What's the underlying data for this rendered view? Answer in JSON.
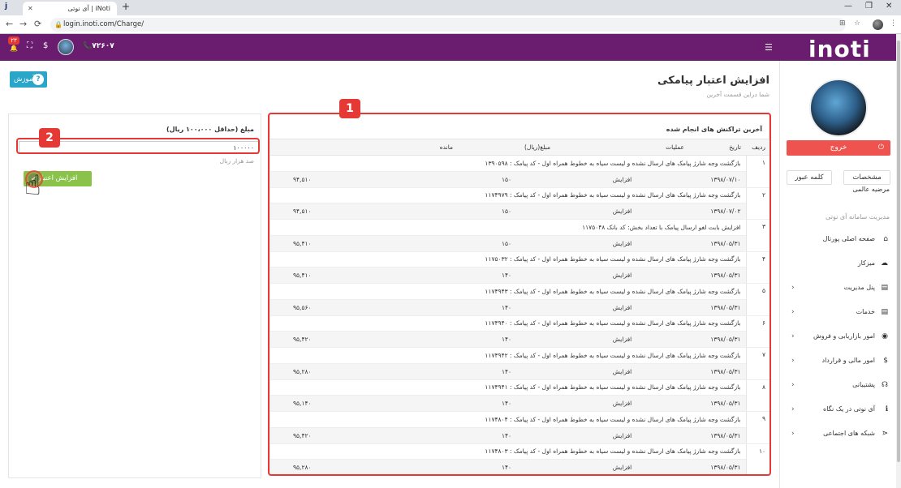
{
  "browser": {
    "tab_title": "iNoti | آی نوتی",
    "url": "login.inoti.com/Charge/",
    "new_tab": "+",
    "back": "←",
    "forward": "→",
    "reload": "⟳",
    "minimize": "—",
    "maximize": "❐",
    "close": "✕"
  },
  "header": {
    "logo": "inoti",
    "phone": "۷۲۶۰۷",
    "badge": "۲۳"
  },
  "page": {
    "title": "افزایش اعتبار پیامکی",
    "subtitle": "شما دراین قسمت آخرین",
    "help_label": "آموزش"
  },
  "charge_form": {
    "label": "مبلغ (حداقل ۱۰۰،۰۰۰ ریال)",
    "value": "۱۰۰۰۰۰",
    "hint": "صد هزار ریال",
    "submit_label": "افزایش اعتبار"
  },
  "transactions": {
    "title": "آخرین تراکنش های انجام شده",
    "columns": [
      "ردیف",
      "تاریخ",
      "عملیات",
      "مبلغ(ریال)",
      "مانده"
    ],
    "rows": [
      {
        "n": "۱",
        "desc": "بازگشت وجه شارژ پیامک های ارسال نشده و لیست سیاه به خطوط همراه اول - کد پیامک : ۱۳۹۰۵۹۸",
        "date": "۱۳۹۸/۰۷/۱۰",
        "op": "افزایش",
        "amount": "۱۵۰",
        "balance": "۹۴,۵۱۰"
      },
      {
        "n": "۲",
        "desc": "بازگشت وجه شارژ پیامک های ارسال نشده و لیست سیاه به خطوط همراه اول - کد پیامک : ۱۱۷۴۹۷۹",
        "date": "۱۳۹۸/۰۷/۰۲",
        "op": "افزایش",
        "amount": "۱۵۰",
        "balance": "۹۴,۵۱۰"
      },
      {
        "n": "۳",
        "desc": "افزایش بابت لغو ارسال پیامک با تعداد بخش: کد بانک ۱۱۷۵۰۴۸",
        "date": "۱۳۹۸/۰۵/۳۱",
        "op": "افزایش",
        "amount": "۱۵۰",
        "balance": "۹۵,۴۱۰"
      },
      {
        "n": "۴",
        "desc": "بازگشت وجه شارژ پیامک های ارسال نشده و لیست سیاه به خطوط همراه اول - کد پیامک : ۱۱۷۵۰۳۲",
        "date": "۱۳۹۸/۰۵/۳۱",
        "op": "افزایش",
        "amount": "۱۴۰",
        "balance": "۹۵,۴۱۰"
      },
      {
        "n": "۵",
        "desc": "بازگشت وجه شارژ پیامک های ارسال نشده و لیست سیاه به خطوط همراه اول - کد پیامک : ۱۱۷۴۹۴۳",
        "date": "۱۳۹۸/۰۵/۳۱",
        "op": "افزایش",
        "amount": "۱۴۰",
        "balance": "۹۵,۵۶۰"
      },
      {
        "n": "۶",
        "desc": "بازگشت وجه شارژ پیامک های ارسال نشده و لیست سیاه به خطوط همراه اول - کد پیامک : ۱۱۷۴۹۴۰",
        "date": "۱۳۹۸/۰۵/۳۱",
        "op": "افزایش",
        "amount": "۱۴۰",
        "balance": "۹۵,۴۲۰"
      },
      {
        "n": "۷",
        "desc": "بازگشت وجه شارژ پیامک های ارسال نشده و لیست سیاه به خطوط همراه اول - کد پیامک : ۱۱۷۴۹۴۲",
        "date": "۱۳۹۸/۰۵/۳۱",
        "op": "افزایش",
        "amount": "۱۴۰",
        "balance": "۹۵,۲۸۰"
      },
      {
        "n": "۸",
        "desc": "بازگشت وجه شارژ پیامک های ارسال نشده و لیست سیاه به خطوط همراه اول - کد پیامک : ۱۱۷۴۹۴۱",
        "date": "۱۳۹۸/۰۵/۳۱",
        "op": "افزایش",
        "amount": "۱۴۰",
        "balance": "۹۵,۱۴۰"
      },
      {
        "n": "۹",
        "desc": "بازگشت وجه شارژ پیامک های ارسال نشده و لیست سیاه به خطوط همراه اول - کد پیامک : ۱۱۷۴۸۰۴",
        "date": "۱۳۹۸/۰۵/۳۱",
        "op": "افزایش",
        "amount": "۱۴۰",
        "balance": "۹۵,۴۲۰"
      },
      {
        "n": "۱۰",
        "desc": "بازگشت وجه شارژ پیامک های ارسال نشده و لیست سیاه به خطوط همراه اول - کد پیامک : ۱۱۷۴۸۰۳",
        "date": "۱۳۹۸/۰۵/۳۱",
        "op": "افزایش",
        "amount": "۱۴۰",
        "balance": "۹۵,۲۸۰"
      }
    ]
  },
  "sidebar": {
    "logout_label": "خروج",
    "profile_label": "مشخصات",
    "password_label": "کلمه عبور",
    "user_name": "مرضیه عالمی",
    "section_title": "مدیریت سامانه آی نوتی",
    "items": [
      {
        "label": "صفحه اصلی پورتال",
        "icon": "⌂",
        "chevron": ""
      },
      {
        "label": "میزکار",
        "icon": "☁",
        "chevron": ""
      },
      {
        "label": "پنل مدیریت",
        "icon": "▤",
        "chevron": "‹"
      },
      {
        "label": "خدمات",
        "icon": "▤",
        "chevron": "‹"
      },
      {
        "label": "امور بازاریابی و فروش",
        "icon": "◉",
        "chevron": "‹"
      },
      {
        "label": "امور مالی و قرارداد",
        "icon": "$",
        "chevron": "‹"
      },
      {
        "label": "پشتیبانی",
        "icon": "☊",
        "chevron": "‹"
      },
      {
        "label": "آی نوتی در یک نگاه",
        "icon": "ℹ",
        "chevron": "‹"
      },
      {
        "label": "شبکه های اجتماعی",
        "icon": "⋖",
        "chevron": "‹"
      }
    ]
  },
  "annotations": {
    "one": "1",
    "two": "2"
  },
  "colors": {
    "header": "#6a1d6e",
    "logout": "#ef5350",
    "charge_button": "#8bc34a",
    "help_button": "#2aa6c9",
    "annotation": "#e53935"
  }
}
